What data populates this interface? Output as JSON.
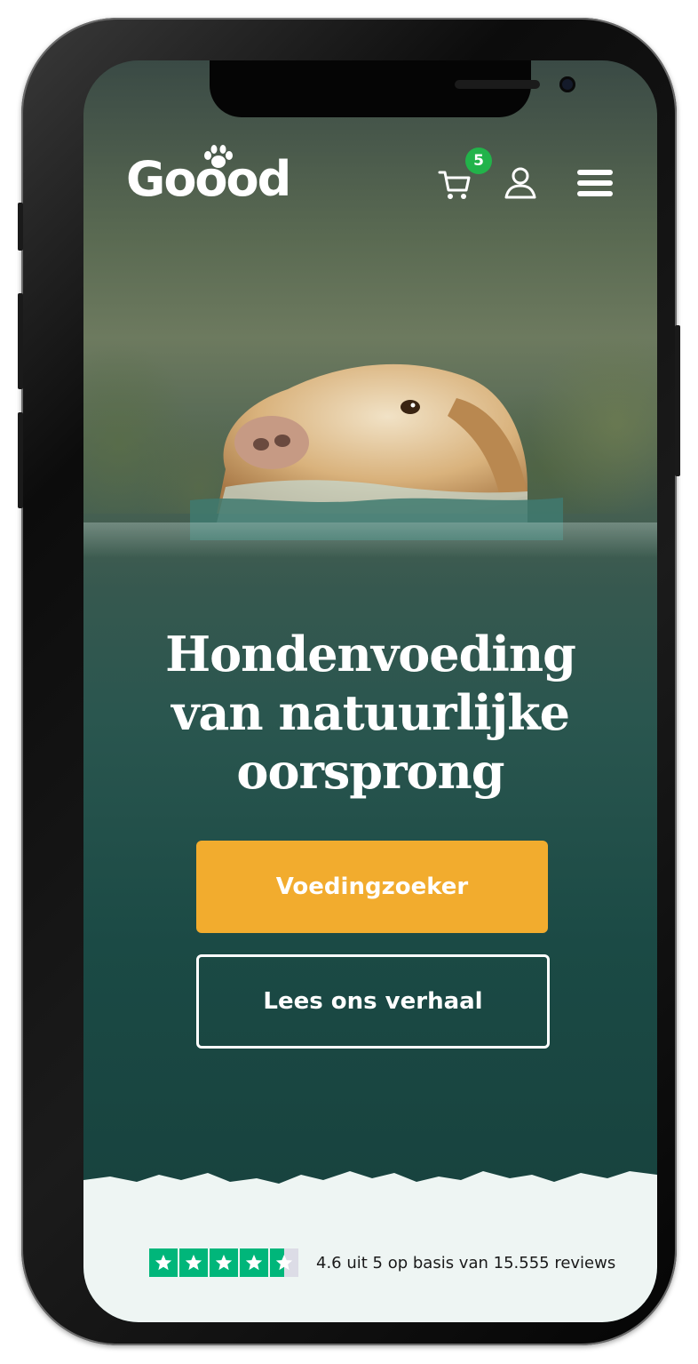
{
  "header": {
    "logo_text": "Goood",
    "cart_count": "5",
    "icons": [
      "cart-icon",
      "account-icon",
      "menu-icon"
    ]
  },
  "hero": {
    "title_line1": "Hondenvoeding",
    "title_line2": "van natuurlijke",
    "title_line3": "oorsprong",
    "primary_button": "Voedingzoeker",
    "secondary_button": "Lees ons verhaal"
  },
  "trustpilot": {
    "rating_text": "4.6 uit 5 op basis van 15.555 reviews",
    "rating_value": 4.6,
    "rating_max": 5
  },
  "colors": {
    "accent": "#f2ac2e",
    "badge": "#22b34a",
    "trust_green": "#00b67a",
    "hero_bg": "#1b4a45",
    "footer_bg": "#eef5f3"
  }
}
